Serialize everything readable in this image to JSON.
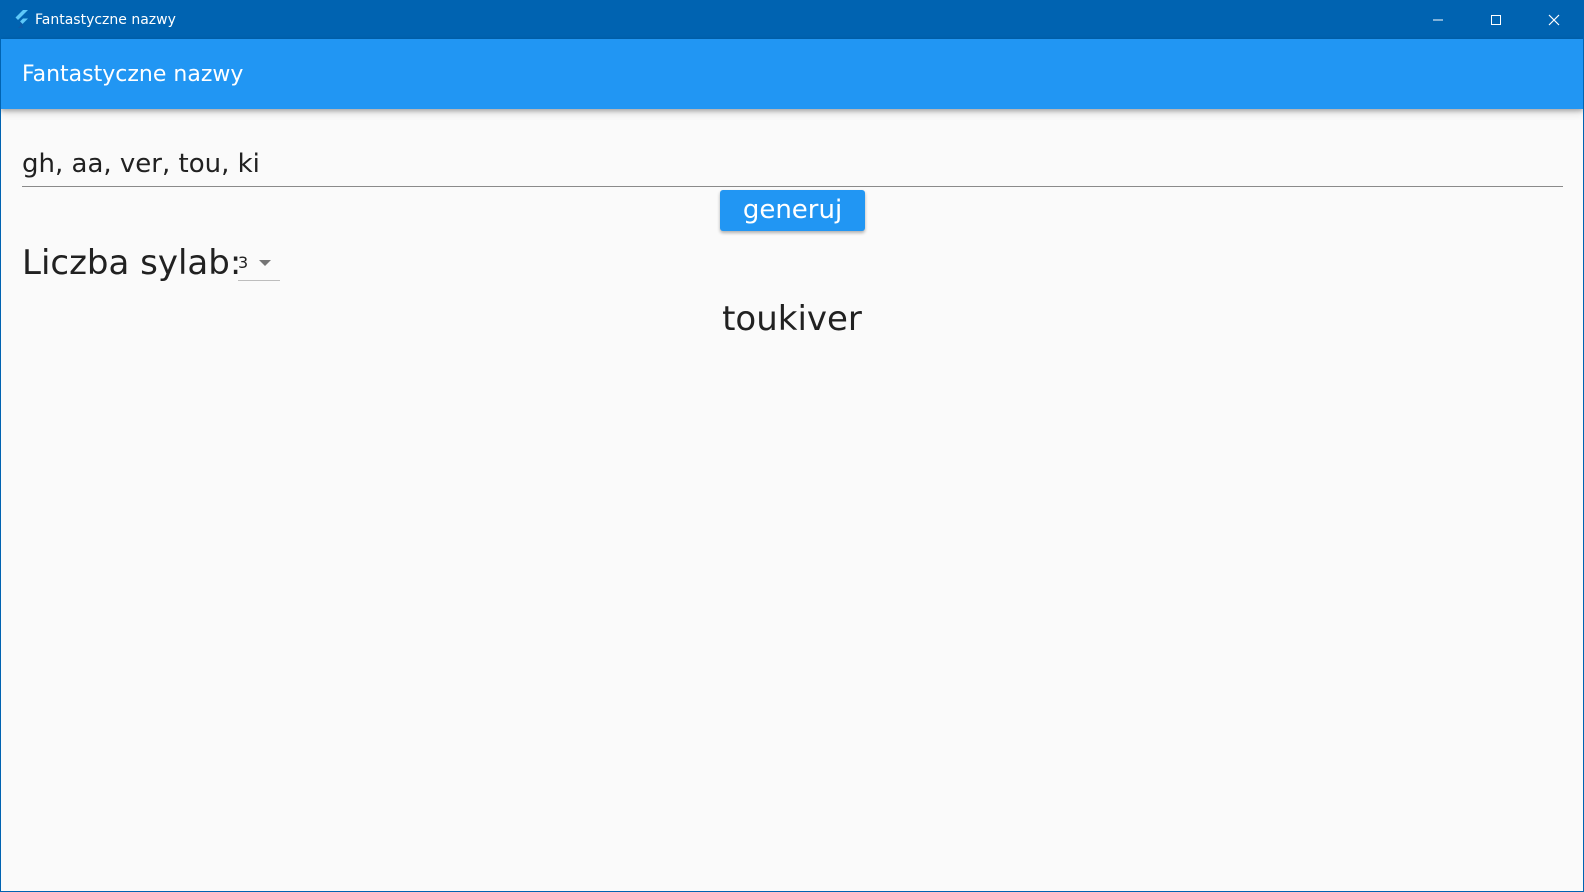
{
  "window": {
    "title": "Fantastyczne nazwy",
    "controls": {
      "minimize_icon": "minimize-icon",
      "maximize_icon": "maximize-icon",
      "close_icon": "close-icon"
    }
  },
  "appbar": {
    "title": "Fantastyczne nazwy"
  },
  "form": {
    "syllables_value": "gh, aa, ver, tou, ki",
    "generate_label": "generuj",
    "syllable_count_label": "Liczba sylab:",
    "syllable_count_value": "3"
  },
  "result": {
    "name": "toukiver"
  },
  "colors": {
    "titlebar": "#0063b1",
    "accent": "#2196f3",
    "background": "#fafafa",
    "text": "#212121"
  }
}
